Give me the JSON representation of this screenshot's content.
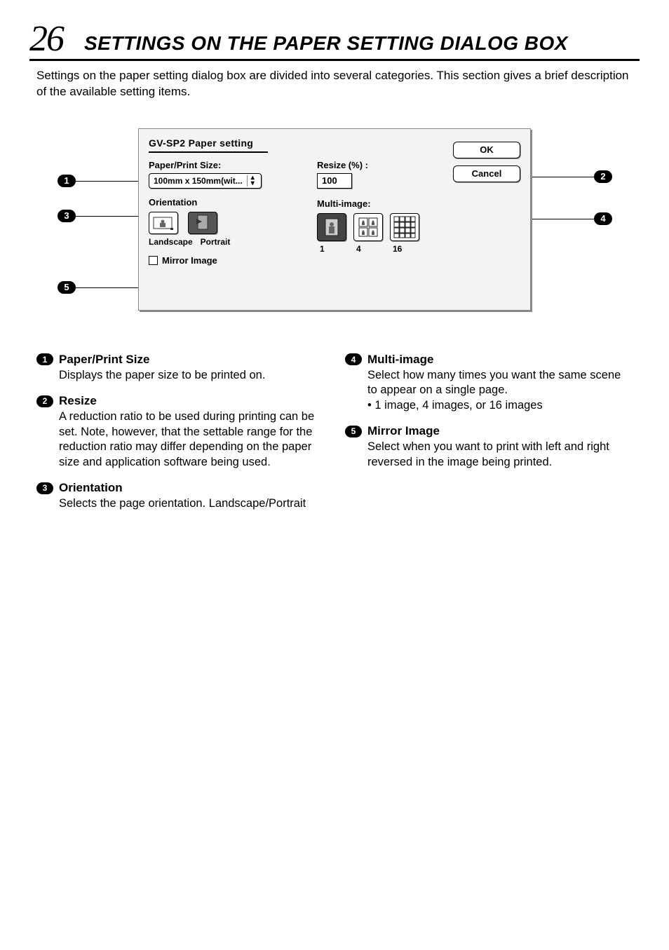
{
  "page_number": "26",
  "page_title": "SETTINGS ON THE PAPER SETTING DIALOG BOX",
  "intro": "Settings on the paper setting dialog box are divided into several categories. This section gives a brief description of the available setting items.",
  "dialog": {
    "title": "GV-SP2 Paper setting",
    "paper_label": "Paper/Print Size:",
    "paper_value": "100mm x 150mm(wit...",
    "orientation_label": "Orientation",
    "orientation_landscape": "Landscape",
    "orientation_portrait": "Portrait",
    "mirror_label": "Mirror Image",
    "resize_label": "Resize (%) :",
    "resize_value": "100",
    "multi_label": "Multi-image:",
    "multi_opts": [
      "1",
      "4",
      "16"
    ],
    "ok": "OK",
    "cancel": "Cancel"
  },
  "callouts": {
    "c1": "1",
    "c2": "2",
    "c3": "3",
    "c4": "4",
    "c5": "5"
  },
  "items": [
    {
      "num": "1",
      "title": "Paper/Print Size",
      "body": "Displays the paper size to be printed on."
    },
    {
      "num": "2",
      "title": "Resize",
      "body": "A reduction ratio to be used during printing can be set. Note, however, that the settable range for the reduction ratio may differ depending on the paper size and application software being used."
    },
    {
      "num": "3",
      "title": "Orientation",
      "body": "Selects the page orientation. Landscape/Portrait"
    },
    {
      "num": "4",
      "title": "Multi-image",
      "body": "Select how many times you want the same scene to appear on a single page.",
      "bullet": "• 1 image, 4 images, or 16 images"
    },
    {
      "num": "5",
      "title": "Mirror Image",
      "body": "Select when you want to print with left and right reversed in the image being printed."
    }
  ]
}
